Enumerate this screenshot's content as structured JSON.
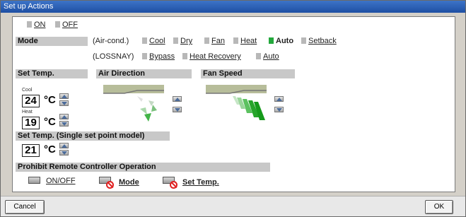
{
  "window": {
    "title": "Set up Actions"
  },
  "top_switch": {
    "on_label": "ON",
    "off_label": "OFF"
  },
  "mode": {
    "label": "Mode",
    "aircond_label": "(Air-cond.)",
    "aircond_options": [
      "Cool",
      "Dry",
      "Fan",
      "Heat",
      "Auto",
      "Setback"
    ],
    "aircond_selected": "Auto",
    "lossnay_label": "(LOSSNAY)",
    "lossnay_options": [
      "Bypass",
      "Heat Recovery",
      "Auto"
    ]
  },
  "set_temp": {
    "label": "Set Temp.",
    "cool_label": "Cool",
    "cool_value": "24",
    "heat_label": "Heat",
    "heat_value": "19",
    "unit": "°C"
  },
  "air_direction": {
    "label": "Air Direction"
  },
  "fan_speed": {
    "label": "Fan Speed"
  },
  "single_set_point": {
    "label": "Set Temp. (Single set point model)",
    "value": "21",
    "unit": "°C"
  },
  "prohibit": {
    "label": "Prohibit Remote Controller Operation",
    "items": [
      "ON/OFF",
      "Mode",
      "Set Temp."
    ]
  },
  "footer": {
    "cancel_label": "Cancel",
    "ok_label": "OK"
  },
  "colors": {
    "accent_green": "#23a83c",
    "title_bar": "#1e4fa3",
    "prohibit_red": "#e02020"
  },
  "icons": [
    "up-arrow-icon",
    "down-arrow-icon",
    "remote-controller-icon",
    "prohibit-icon",
    "louver-icon",
    "fan-speed-icon"
  ]
}
